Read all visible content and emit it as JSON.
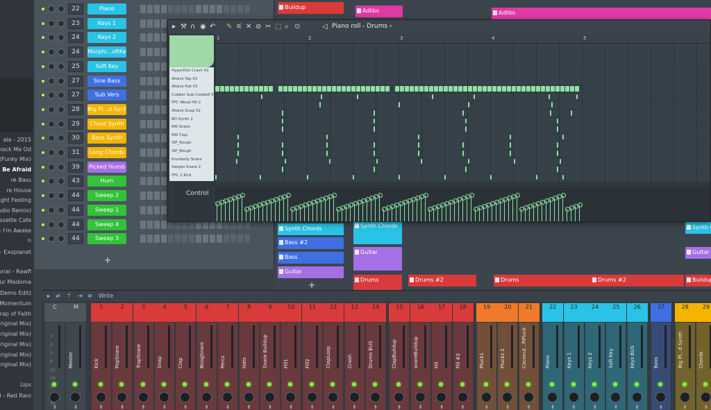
{
  "colors": {
    "bg": "#3a4148",
    "note": "#8de3a3",
    "accent_orange": "#f0a34a",
    "led_green": "#7bff3a",
    "cyan": "#29c3e6",
    "blue": "#3f6fe0",
    "amber": "#f4b400",
    "green": "#33c23a",
    "purple": "#a56fe6",
    "red": "#d93a3a",
    "magenta": "#e03aa5"
  },
  "browser": {
    "items": [
      {
        "text": "ale - 2015",
        "bold": false
      },
      {
        "text": "- Knock Me Od",
        "bold": false
      },
      {
        "text": "y (Funky Mix)",
        "bold": false
      },
      {
        "text": "d To Be Afraid",
        "bold": true
      },
      {
        "text": "re Bass",
        "bold": false
      },
      {
        "text": "re House",
        "bold": false
      },
      {
        "text": "ot Night Feeling",
        "bold": false
      },
      {
        "text": "Studio Remix)",
        "bold": false
      },
      {
        "text": "- Cassette Cafe",
        "bold": false
      },
      {
        "text": "- I'm Awake",
        "bold": false
      },
      {
        "text": "n",
        "bold": false
      },
      {
        "text": "nd - Exoplanet",
        "bold": false
      },
      {
        "text": "torial - Rawfl",
        "bold": false
      },
      {
        "text": "Your Madoma",
        "bold": false
      },
      {
        "text": "(FL Demo Edit)",
        "bold": false
      },
      {
        "text": "Momentum",
        "bold": false
      },
      {
        "text": "rap of Faith",
        "bold": false
      },
      {
        "text": "Original Mix)",
        "bold": false
      },
      {
        "text": "Original Mix)",
        "bold": false
      },
      {
        "text": "riginal Mix)",
        "bold": false
      },
      {
        "text": "Original Mix)",
        "bold": false
      },
      {
        "text": "Original Mix)",
        "bold": false
      },
      {
        "text": "Lips",
        "bold": false
      },
      {
        "text": "wal - Red Rani",
        "bold": false
      }
    ]
  },
  "rack": {
    "channels": [
      {
        "num": "22",
        "name": "Piano",
        "color": "#29c3e6"
      },
      {
        "num": "23",
        "name": "Keys 1",
        "color": "#29c3e6"
      },
      {
        "num": "24",
        "name": "Keys 2",
        "color": "#29c3e6"
      },
      {
        "num": "24",
        "name": "Morphi...oftKey",
        "color": "#29c3e6"
      },
      {
        "num": "25",
        "name": "Soft Key",
        "color": "#29c3e6"
      },
      {
        "num": "27",
        "name": "Sine Bass",
        "color": "#3f6fe0"
      },
      {
        "num": "27",
        "name": "Sub Vers",
        "color": "#3f6fe0"
      },
      {
        "num": "28",
        "name": "Big Pl...d Synth",
        "color": "#f4b400"
      },
      {
        "num": "29",
        "name": "Chord Synth",
        "color": "#f4b400"
      },
      {
        "num": "30",
        "name": "Bass Synth",
        "color": "#f4b400"
      },
      {
        "num": "31",
        "name": "Long Chords",
        "color": "#f4b400"
      },
      {
        "num": "39",
        "name": "Picked Humb",
        "color": "#a56fe6"
      },
      {
        "num": "43",
        "name": "Hum",
        "color": "#33c23a"
      },
      {
        "num": "44",
        "name": "Sweep 2",
        "color": "#33c23a"
      },
      {
        "num": "44",
        "name": "Sweep 1",
        "color": "#33c23a"
      },
      {
        "num": "44",
        "name": "Sweep 4",
        "color": "#33c23a"
      },
      {
        "num": "44",
        "name": "Sweep 3",
        "color": "#33c23a"
      }
    ],
    "add_label": "+"
  },
  "playlist": {
    "clips": [
      {
        "label": "Buildup",
        "color": "#d93a3a"
      },
      {
        "label": "Adlibs",
        "color": "#e03aa5"
      },
      {
        "label": "Adlibs",
        "color": "#e03aa5"
      },
      {
        "label": "Synth Chords",
        "color": "#29c3e6"
      },
      {
        "label": "Bass #2",
        "color": "#3f6fe0"
      },
      {
        "label": "Bass",
        "color": "#3f6fe0"
      },
      {
        "label": "Guitar",
        "color": "#a56fe6"
      },
      {
        "label": "Synth Chords",
        "color": "#29c3e6"
      },
      {
        "label": "Guitar",
        "color": "#a56fe6"
      },
      {
        "label": "Drums",
        "color": "#d93a3a"
      },
      {
        "label": "Drums #2",
        "color": "#d93a3a"
      },
      {
        "label": "Drums",
        "color": "#d93a3a"
      },
      {
        "label": "Drums #2",
        "color": "#d93a3a"
      },
      {
        "label": "Buildup",
        "color": "#d93a3a"
      },
      {
        "label": "Guitar",
        "color": "#a56fe6"
      },
      {
        "label": "Synth Ch",
        "color": "#29c3e6"
      }
    ],
    "add_label": "+"
  },
  "pianoroll": {
    "title": "Piano roll - Drums",
    "title_suffix": "›",
    "ruler": [
      "1",
      "2",
      "3",
      "4",
      "5"
    ],
    "keys": [
      "HyperDist Crash 01",
      "Attack Tap 02",
      "Attack Hat 01",
      "Cubber Sub Cowbell 01",
      "FPC Wood Hit 2",
      "Attack Snap 02",
      "BD Synth 2",
      "RW Snare",
      "RW Clap",
      "ISP_Rough",
      "ISP_Rough",
      "Krunkedy Snare",
      "Swiges Snare 2",
      "FPC 2 Kick"
    ],
    "control_label": "Control"
  },
  "mixer": {
    "write_label": "Write",
    "strips": [
      {
        "num": "C",
        "name": "",
        "color": "#4e565d"
      },
      {
        "num": "M",
        "name": "Master",
        "color": "#4e565d"
      },
      {
        "num": "1",
        "name": "Kick",
        "color": "#d93a3a"
      },
      {
        "num": "2",
        "name": "PopSnare",
        "color": "#d93a3a"
      },
      {
        "num": "3",
        "name": "TrapSnare",
        "color": "#d93a3a"
      },
      {
        "num": "4",
        "name": "Snap",
        "color": "#d93a3a"
      },
      {
        "num": "5",
        "name": "Clap",
        "color": "#d93a3a"
      },
      {
        "num": "6",
        "name": "BoogSnare",
        "color": "#d93a3a"
      },
      {
        "num": "7",
        "name": "Percs",
        "color": "#d93a3a"
      },
      {
        "num": "8",
        "name": "Hats",
        "color": "#d93a3a"
      },
      {
        "num": "9",
        "name": "Snare Buildup",
        "color": "#d93a3a"
      },
      {
        "num": "10",
        "name": "Fill1",
        "color": "#d93a3a"
      },
      {
        "num": "11",
        "name": "Fill2",
        "color": "#d93a3a"
      },
      {
        "num": "12",
        "name": "ClapLoop",
        "color": "#d93a3a"
      },
      {
        "num": "13",
        "name": "Crash",
        "color": "#d93a3a"
      },
      {
        "num": "14",
        "name": "Drums BUS",
        "color": "#d93a3a"
      },
      {
        "num": "15",
        "name": "ClapBuildup",
        "color": "#d93a3a"
      },
      {
        "num": "16",
        "name": "snareBuildup",
        "color": "#d93a3a"
      },
      {
        "num": "17",
        "name": "Fill",
        "color": "#d93a3a"
      },
      {
        "num": "18",
        "name": "Fill #2",
        "color": "#d93a3a"
      },
      {
        "num": "19",
        "name": "Pluck1",
        "color": "#f07a2a"
      },
      {
        "num": "20",
        "name": "Plucks 2",
        "color": "#f07a2a"
      },
      {
        "num": "21",
        "name": "Coconut...ftPluck",
        "color": "#f07a2a"
      },
      {
        "num": "22",
        "name": "Piano",
        "color": "#29c3e6"
      },
      {
        "num": "23",
        "name": "Keys 1",
        "color": "#29c3e6"
      },
      {
        "num": "24",
        "name": "Keys 2",
        "color": "#29c3e6"
      },
      {
        "num": "25",
        "name": "Soft Key",
        "color": "#29c3e6"
      },
      {
        "num": "26",
        "name": "Keys BUS",
        "color": "#29c3e6"
      },
      {
        "num": "27",
        "name": "Bass",
        "color": "#3f6fe0"
      },
      {
        "num": "28",
        "name": "Big Pl...d Synth",
        "color": "#f4b400"
      },
      {
        "num": "29",
        "name": "Chords",
        "color": "#f4b400"
      }
    ]
  }
}
